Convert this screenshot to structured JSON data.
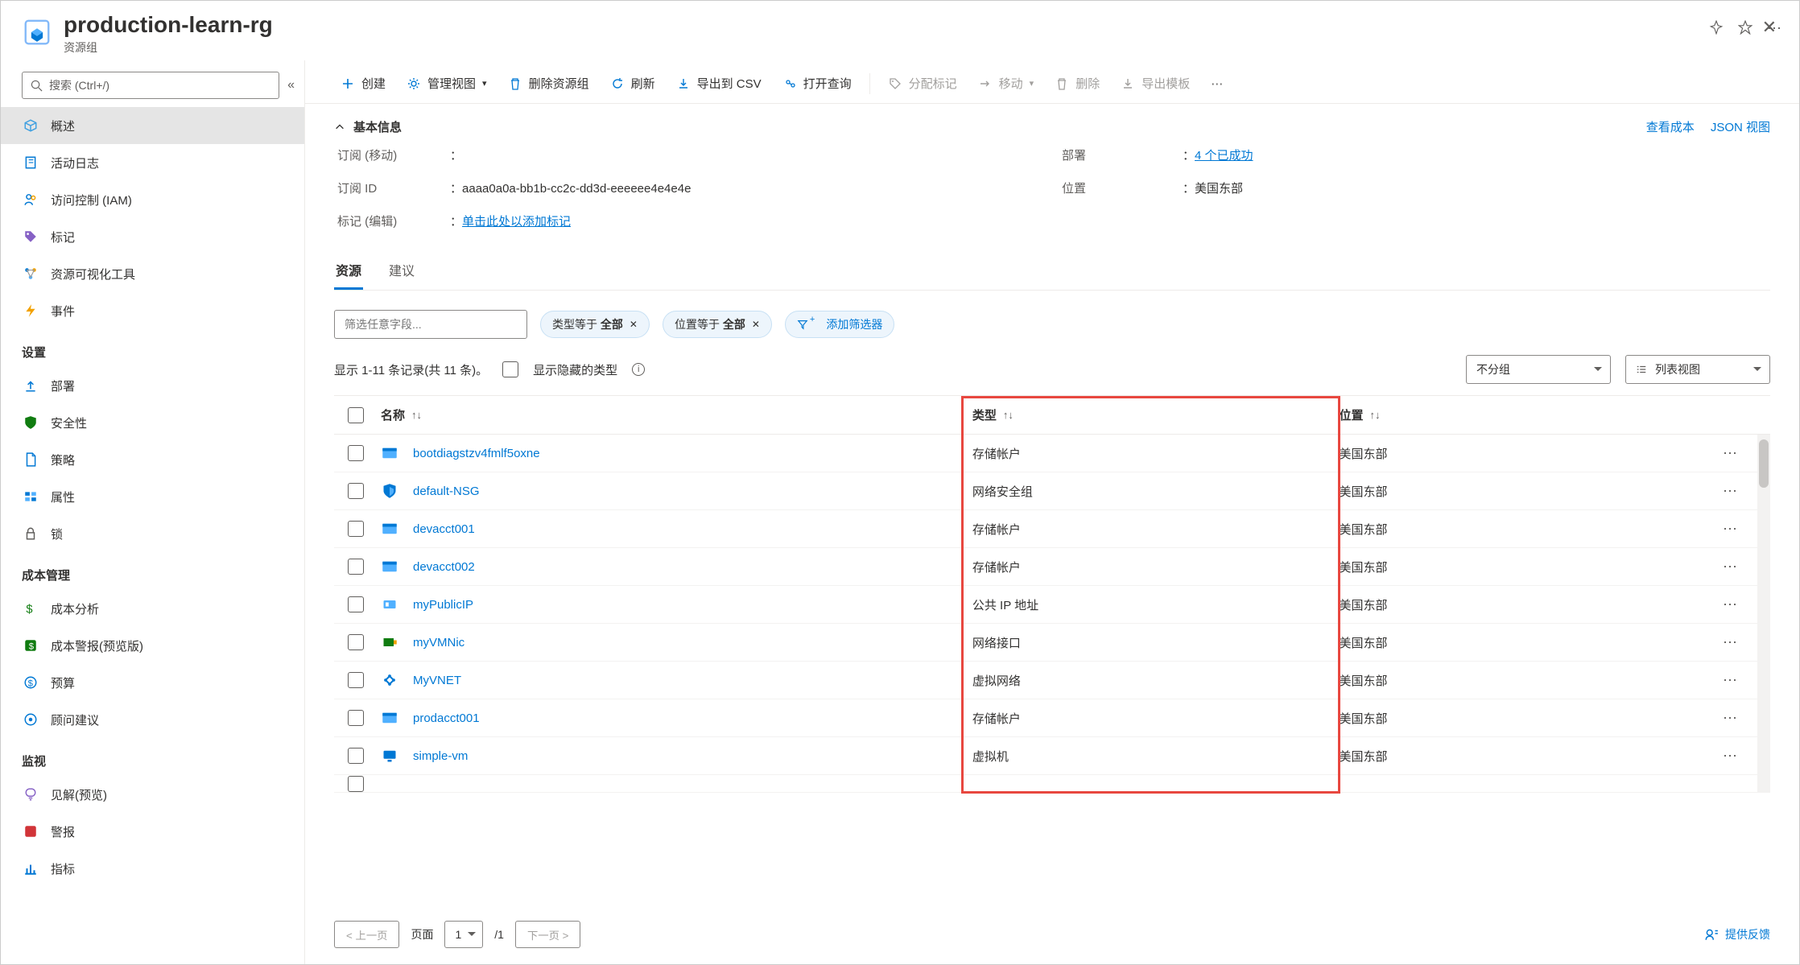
{
  "header": {
    "title": "production-learn-rg",
    "subtitle": "资源组",
    "pin_title": "固定",
    "fav_title": "收藏",
    "more_title": "更多"
  },
  "sidebar": {
    "search_placeholder": "搜索 (Ctrl+/)",
    "items": [
      {
        "key": "overview",
        "label": "概述",
        "icon": "cube",
        "active": true
      },
      {
        "key": "activity",
        "label": "活动日志",
        "icon": "notebook"
      },
      {
        "key": "iam",
        "label": "访问控制 (IAM)",
        "icon": "people"
      },
      {
        "key": "tags",
        "label": "标记",
        "icon": "tag"
      },
      {
        "key": "vis",
        "label": "资源可视化工具",
        "icon": "graph"
      },
      {
        "key": "events",
        "label": "事件",
        "icon": "bolt"
      }
    ],
    "sections": [
      {
        "title": "设置",
        "items": [
          {
            "key": "deploy",
            "label": "部署",
            "icon": "upload"
          },
          {
            "key": "security",
            "label": "安全性",
            "icon": "shield"
          },
          {
            "key": "policy",
            "label": "策略",
            "icon": "doc"
          },
          {
            "key": "props",
            "label": "属性",
            "icon": "props"
          },
          {
            "key": "lock",
            "label": "锁",
            "icon": "lock"
          }
        ]
      },
      {
        "title": "成本管理",
        "items": [
          {
            "key": "cost-analysis",
            "label": "成本分析",
            "icon": "cost"
          },
          {
            "key": "cost-alert",
            "label": "成本警报(预览版)",
            "icon": "alert"
          },
          {
            "key": "budget",
            "label": "预算",
            "icon": "money"
          },
          {
            "key": "advisor",
            "label": "顾问建议",
            "icon": "advisor"
          }
        ]
      },
      {
        "title": "监视",
        "items": [
          {
            "key": "insights",
            "label": "见解(预览)",
            "icon": "bulb"
          },
          {
            "key": "alerts2",
            "label": "警报",
            "icon": "bell-red"
          },
          {
            "key": "metrics",
            "label": "指标",
            "icon": "chart"
          }
        ]
      }
    ]
  },
  "toolbar": {
    "create": "创建",
    "manage_view": "管理视图",
    "delete_rg": "删除资源组",
    "refresh": "刷新",
    "export_csv": "导出到 CSV",
    "open_query": "打开查询",
    "assign_tags": "分配标记",
    "move": "移动",
    "delete": "删除",
    "export_tpl": "导出模板",
    "more": "..."
  },
  "essentials": {
    "header": "基本信息",
    "view_costs": "查看成本",
    "json_view": "JSON 视图",
    "sub_label": "订阅",
    "sub_move": "移动",
    "sub_colon": "：",
    "subid_label": "订阅 ID",
    "subid_val": "aaaa0a0a-bb1b-cc2c-dd3d-eeeeee4e4e4e",
    "subid_colon": "：",
    "deploy_label": "部署",
    "deploy_val": "4 个已成功",
    "deploy_colon": "：",
    "loc_label": "位置",
    "loc_val": "美国东部",
    "loc_colon": "：",
    "tags_label": "标记",
    "tags_edit": "编辑",
    "tags_add": "单击此处以添加标记",
    "tags_colon": "："
  },
  "tabs": {
    "resources": "资源",
    "advisor": "建议"
  },
  "filter": {
    "placeholder": "筛选任意字段...",
    "type_prefix": "类型等于",
    "type_val": "全部",
    "loc_prefix": "位置等于",
    "loc_val": "全部",
    "add": "添加筛选器"
  },
  "count": {
    "text": "显示 1-11 条记录(共 11 条)。",
    "hidden": "显示隐藏的类型"
  },
  "dropdowns": {
    "group": "不分组",
    "view": "列表视图"
  },
  "table": {
    "name_hdr": "名称",
    "type_hdr": "类型",
    "loc_hdr": "位置",
    "rows": [
      {
        "name": "bootdiagstzv4fmlf5oxne",
        "type": "存储帐户",
        "loc": "美国东部",
        "icon": "storage"
      },
      {
        "name": "default-NSG",
        "type": "网络安全组",
        "loc": "美国东部",
        "icon": "nsg"
      },
      {
        "name": "devacct001",
        "type": "存储帐户",
        "loc": "美国东部",
        "icon": "storage"
      },
      {
        "name": "devacct002",
        "type": "存储帐户",
        "loc": "美国东部",
        "icon": "storage"
      },
      {
        "name": "myPublicIP",
        "type": "公共 IP 地址",
        "loc": "美国东部",
        "icon": "ip"
      },
      {
        "name": "myVMNic",
        "type": "网络接口",
        "loc": "美国东部",
        "icon": "nic"
      },
      {
        "name": "MyVNET",
        "type": "虚拟网络",
        "loc": "美国东部",
        "icon": "vnet"
      },
      {
        "name": "prodacct001",
        "type": "存储帐户",
        "loc": "美国东部",
        "icon": "storage"
      },
      {
        "name": "simple-vm",
        "type": "虚拟机",
        "loc": "美国东部",
        "icon": "vm"
      }
    ]
  },
  "pager": {
    "prev": "< 上一页",
    "page_lbl": "页面",
    "page": "1",
    "total": "/1",
    "next": "下一页 >",
    "feedback": "提供反馈"
  }
}
